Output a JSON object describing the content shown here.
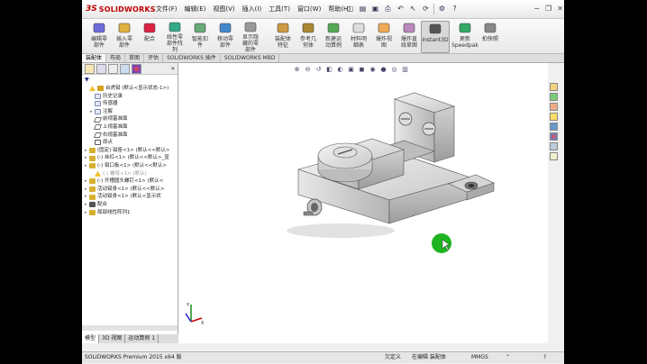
{
  "title_bar": {
    "logo_ds": "3S",
    "logo_text": "SOLIDWORKS",
    "menu": [
      "文件(F)",
      "编辑(E)",
      "视图(V)",
      "插入(I)",
      "工具(T)",
      "窗口(W)",
      "帮助(H)"
    ]
  },
  "ribbon": {
    "buttons": [
      {
        "label": "编辑零\n部件",
        "name": "edit-component-button"
      },
      {
        "label": "插入零\n部件",
        "name": "insert-component-button"
      },
      {
        "label": "配合",
        "name": "mate-button"
      },
      {
        "label": "线性零\n部件阵\n列",
        "name": "linear-pattern-button"
      },
      {
        "label": "智能扣\n件",
        "name": "smart-fastener-button"
      },
      {
        "label": "移动零\n部件",
        "name": "move-component-button"
      },
      {
        "label": "显示隐\n藏的零\n部件",
        "name": "show-hidden-button"
      },
      {
        "label": "装配体\n特征",
        "name": "assembly-feature-button"
      },
      {
        "label": "参考几\n何体",
        "name": "reference-geometry-button"
      },
      {
        "label": "新建运\n动算例",
        "name": "new-motion-study-button"
      },
      {
        "label": "材料明\n细表",
        "name": "bom-button"
      },
      {
        "label": "爆炸视\n图",
        "name": "exploded-view-button"
      },
      {
        "label": "爆炸直\n线草图",
        "name": "explode-line-sketch-button"
      },
      {
        "label": "Instant3D",
        "name": "instant3d-button"
      },
      {
        "label": "更新\nSpeedpak",
        "name": "update-speedpak-button"
      },
      {
        "label": "拍快照",
        "name": "snapshot-button"
      }
    ]
  },
  "tabs": [
    "装配体",
    "布局",
    "草图",
    "评估",
    "SOLIDWORKS 插件",
    "SOLIDWORKS MBD"
  ],
  "tree": [
    {
      "text": "台虎钳  (默认<显示状态-1>)",
      "icon": "asm",
      "level": 0,
      "exp": "",
      "warn": true
    },
    {
      "text": "历史记录",
      "icon": "doc",
      "level": 1,
      "exp": ""
    },
    {
      "text": "传感器",
      "icon": "doc",
      "level": 1,
      "exp": ""
    },
    {
      "text": "注解",
      "icon": "doc",
      "level": 1,
      "exp": "▸"
    },
    {
      "text": "前视基准面",
      "icon": "plane",
      "level": 1,
      "exp": ""
    },
    {
      "text": "上视基准面",
      "icon": "plane",
      "level": 1,
      "exp": ""
    },
    {
      "text": "右视基准面",
      "icon": "plane",
      "level": 1,
      "exp": ""
    },
    {
      "text": "原点",
      "icon": "origin",
      "level": 1,
      "exp": ""
    },
    {
      "text": "(固定) 钳座<1> (默认<<默认>",
      "icon": "part",
      "level": 0,
      "exp": "▸"
    },
    {
      "text": "(-) 丝杠<1> (默认<<默认>_显",
      "icon": "part",
      "level": 0,
      "exp": "▸"
    },
    {
      "text": "(-) 钳口板<1> (默认<<默认>",
      "icon": "part",
      "level": 0,
      "exp": "▸"
    },
    {
      "text": "(-) 螺母<1> (默认)",
      "icon": "warn",
      "level": 1,
      "exp": "",
      "faded": true
    },
    {
      "text": "(-) 开槽圆头螺钉<1> (默认<",
      "icon": "part",
      "level": 0,
      "exp": "▸"
    },
    {
      "text": "活动钳身<1> (默认<<默认>",
      "icon": "part",
      "level": 0,
      "exp": "▸"
    },
    {
      "text": "活动钳身<1> (默认<显示状",
      "icon": "part",
      "level": 0,
      "exp": "▸"
    },
    {
      "text": "配合",
      "icon": "mate",
      "level": 0,
      "exp": "▸"
    },
    {
      "text": "局部线性阵列1",
      "icon": "part",
      "level": 0,
      "exp": "▸"
    }
  ],
  "panel_tabs": [
    "模型",
    "3D 视图",
    "运动算例 1"
  ],
  "status": {
    "left": "SOLIDWORKS Premium 2015 x64 版",
    "state": "欠定义",
    "mode": "在编辑 装配体",
    "units": "MMGS"
  }
}
